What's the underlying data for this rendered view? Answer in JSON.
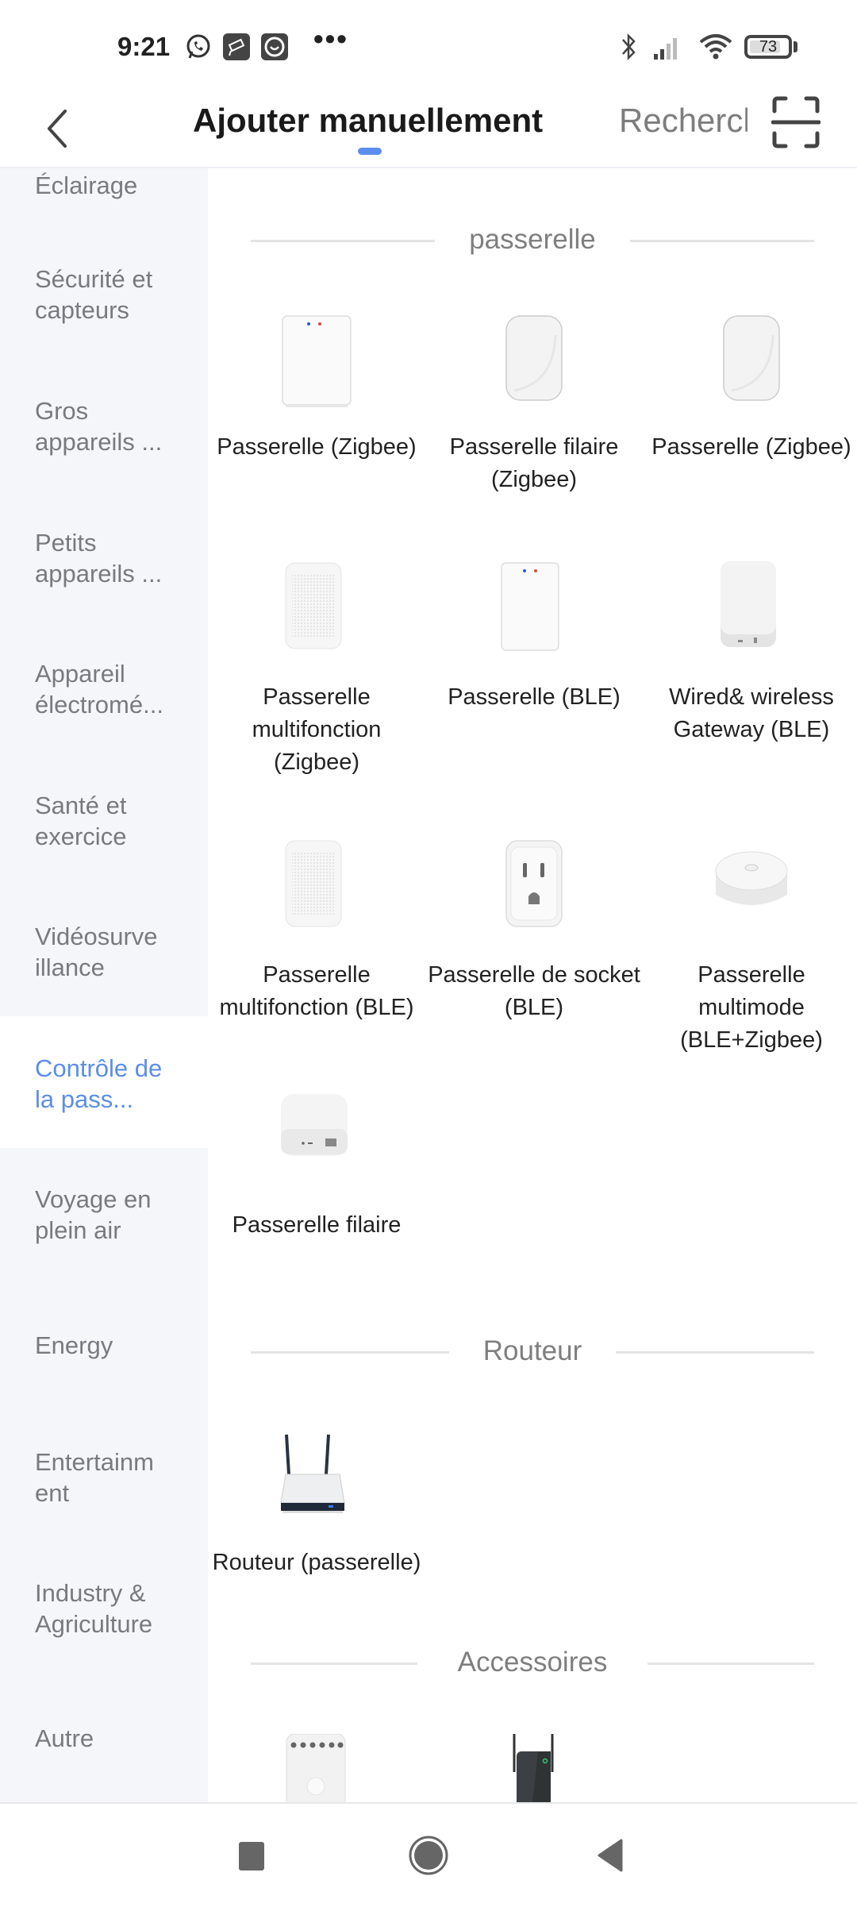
{
  "status_bar": {
    "time": "9:21",
    "notification_icons": [
      "whatsapp-icon",
      "camera-app-icon",
      "smiley-app-icon"
    ],
    "more_indicator": "•••",
    "system_icons": [
      "bluetooth-icon",
      "signal-icon",
      "wifi-icon"
    ],
    "battery_level": "73"
  },
  "header": {
    "back_label": "Retour",
    "title": "Ajouter manuellement",
    "second_tab": "Recherche",
    "scan_label": "Scanner"
  },
  "sidebar": {
    "active_index": 7,
    "items": [
      {
        "label": "Éclairage"
      },
      {
        "label": "Sécurité et capteurs"
      },
      {
        "label": "Gros appareils ..."
      },
      {
        "label": "Petits appareils ..."
      },
      {
        "label": "Appareil électromé..."
      },
      {
        "label": "Santé et exercice"
      },
      {
        "label": "Vidéosurve illance"
      },
      {
        "label": "Contrôle de la pass..."
      },
      {
        "label": "Voyage en plein air"
      },
      {
        "label": "Energy"
      },
      {
        "label": "Entertainm ent"
      },
      {
        "label": "Industry & Agriculture"
      },
      {
        "label": "Autre"
      }
    ]
  },
  "sections": [
    {
      "title": "passerelle",
      "items": [
        {
          "label": "Passerelle (Zigbee)",
          "icon": "white-hub-leds"
        },
        {
          "label": "Passerelle filaire (Zigbee)",
          "icon": "rounded-hub"
        },
        {
          "label": "Passerelle (Zigbee)",
          "icon": "rounded-hub"
        },
        {
          "label": "Passerelle multifonction (Zigbee)",
          "icon": "speaker-hub"
        },
        {
          "label": "Passerelle (BLE)",
          "icon": "white-hub-leds"
        },
        {
          "label": "Wired& wireless Gateway (BLE)",
          "icon": "hub-ports"
        },
        {
          "label": "Passerelle multifonction (BLE)",
          "icon": "speaker-hub"
        },
        {
          "label": "Passerelle de socket (BLE)",
          "icon": "socket-plug"
        },
        {
          "label": "Passerelle multimode (BLE+Zigbee)",
          "icon": "round-puck"
        },
        {
          "label": "Passerelle filaire",
          "icon": "ethernet-hub"
        }
      ]
    },
    {
      "title": "Routeur",
      "items": [
        {
          "label": "Routeur (passerelle)",
          "icon": "router"
        }
      ]
    },
    {
      "title": "Accessoires",
      "items": [
        {
          "label": "",
          "icon": "power-strip"
        },
        {
          "label": "",
          "icon": "wifi-extender"
        }
      ]
    }
  ],
  "nav_bar": {
    "recents_label": "Récents",
    "home_label": "Accueil",
    "back_label": "Retour"
  }
}
